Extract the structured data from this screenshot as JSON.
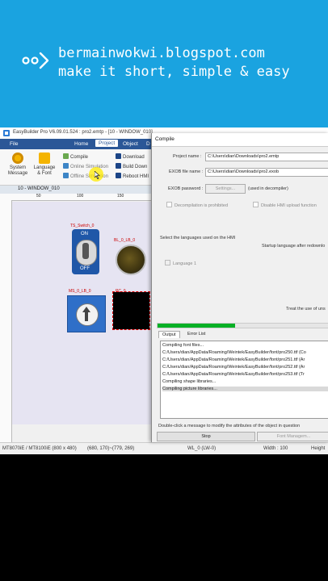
{
  "banner": {
    "line1": "bermainwokwi.blogspot.com",
    "line2": "make it short, simple & easy",
    "bg_color": "#1aa3e0"
  },
  "app": {
    "title": "EasyBuilder Pro V6.09.01.524 : pro2.emtp - [10 - WINDOW_010]",
    "menu": [
      "File",
      "Home",
      "Project",
      "Object",
      "D"
    ],
    "ribbon": {
      "system_message": "System Message",
      "language_font": "Language & Font",
      "compile": "Compile",
      "online_simulation": "Online Simulation",
      "offline_simulation": "Offline Simulation",
      "download": "Download",
      "build_download": "Build Down",
      "reboot": "Reboot HMI"
    },
    "doc_tab": "10 - WINDOW_010",
    "ruler_ticks": [
      "50",
      "100",
      "150"
    ],
    "canvas": {
      "toggle_label_top": "TS_Switch_0",
      "toggle_on": "ON",
      "toggle_off": "OFF",
      "lamp_label": "BL_0_LB_0",
      "selector_label": "MS_0_LB_0",
      "black_label": "PC_0",
      "bg_color": "#e6e4f2"
    },
    "status": {
      "model": "MT8070iE / MT8100iE (800 x 480)",
      "coords": "(680, 170)~(779, 269)",
      "address": "WL_0 (LW-0)",
      "width": "Width : 100",
      "height": "Height"
    }
  },
  "dialog": {
    "title": "Compile",
    "project_name_label": "Project name :",
    "project_name_value": "C:\\Users\\dian\\Downloads\\pro2.emtp",
    "exob_label": "EXOB file name :",
    "exob_value": "C:\\Users\\dian\\Downloads\\pro2.exob",
    "exob_password_label": "EXOB password :",
    "settings_button": "Settings...",
    "decompiler_note": "(used in decompiler)",
    "decompilation_prohibited": "Decompilation is prohibited",
    "disable_upload": "Disable HMI upload function",
    "select_languages": "Select the languages used on the HMI",
    "startup_language": "Startup language after redownlo",
    "language_1": "Language 1",
    "treat_use": "Treat the use of uns",
    "progress": 0.45,
    "tabs": {
      "output": "Output",
      "error": "Error List"
    },
    "output_lines": [
      "Compiling font files...",
      "C:/Users/dian/AppData/Roaming/Weintek/EasyBuilder/font/pro250.ttf (Co",
      "C:/Users/dian/AppData/Roaming/Weintek/EasyBuilder/font/pro251.ttf (Ar",
      "C:/Users/dian/AppData/Roaming/Weintek/EasyBuilder/font/pro252.ttf (Ar",
      "C:/Users/dian/AppData/Roaming/Weintek/EasyBuilder/font/pro253.ttf (Tr",
      "Compiling shape libraries...",
      "Compiling picture libraries..."
    ],
    "hint": "Double-click a message to modify the attributes of the object in question",
    "stop_button": "Stop",
    "font_management": "Font Managem..."
  }
}
